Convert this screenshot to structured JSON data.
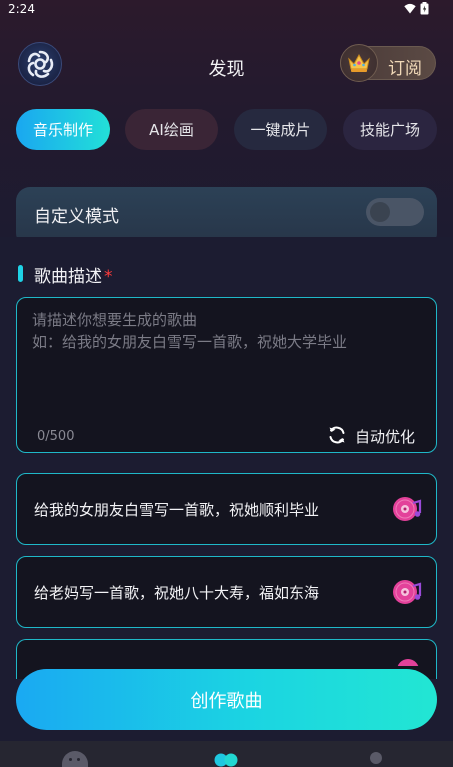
{
  "status_bar": {
    "time": "2:24"
  },
  "header": {
    "title": "发现",
    "subscribe_label": "订阅"
  },
  "tabs": [
    {
      "label": "音乐制作",
      "active": true
    },
    {
      "label": "AI绘画",
      "active": false
    },
    {
      "label": "一键成片",
      "active": false
    },
    {
      "label": "技能广场",
      "active": false
    }
  ],
  "custom_mode": {
    "label": "自定义模式",
    "enabled": false
  },
  "song_description": {
    "title": "歌曲描述",
    "required_mark": "*",
    "placeholder_line1": "请描述你想要生成的歌曲",
    "placeholder_line2": "如：给我的女朋友白雪写一首歌，祝她大学毕业",
    "char_count": "0/500",
    "optimize_label": "自动优化"
  },
  "examples": [
    "给我的女朋友白雪写一首歌，祝她顺利毕业",
    "给老妈写一首歌，祝她八十大寿，福如东海"
  ],
  "create_button": {
    "label": "创作歌曲"
  },
  "colors": {
    "accent_start": "#1aa7f0",
    "accent_end": "#22e0d8",
    "required": "#ff3b3b",
    "subscribe_text": "#f1d9b8"
  }
}
